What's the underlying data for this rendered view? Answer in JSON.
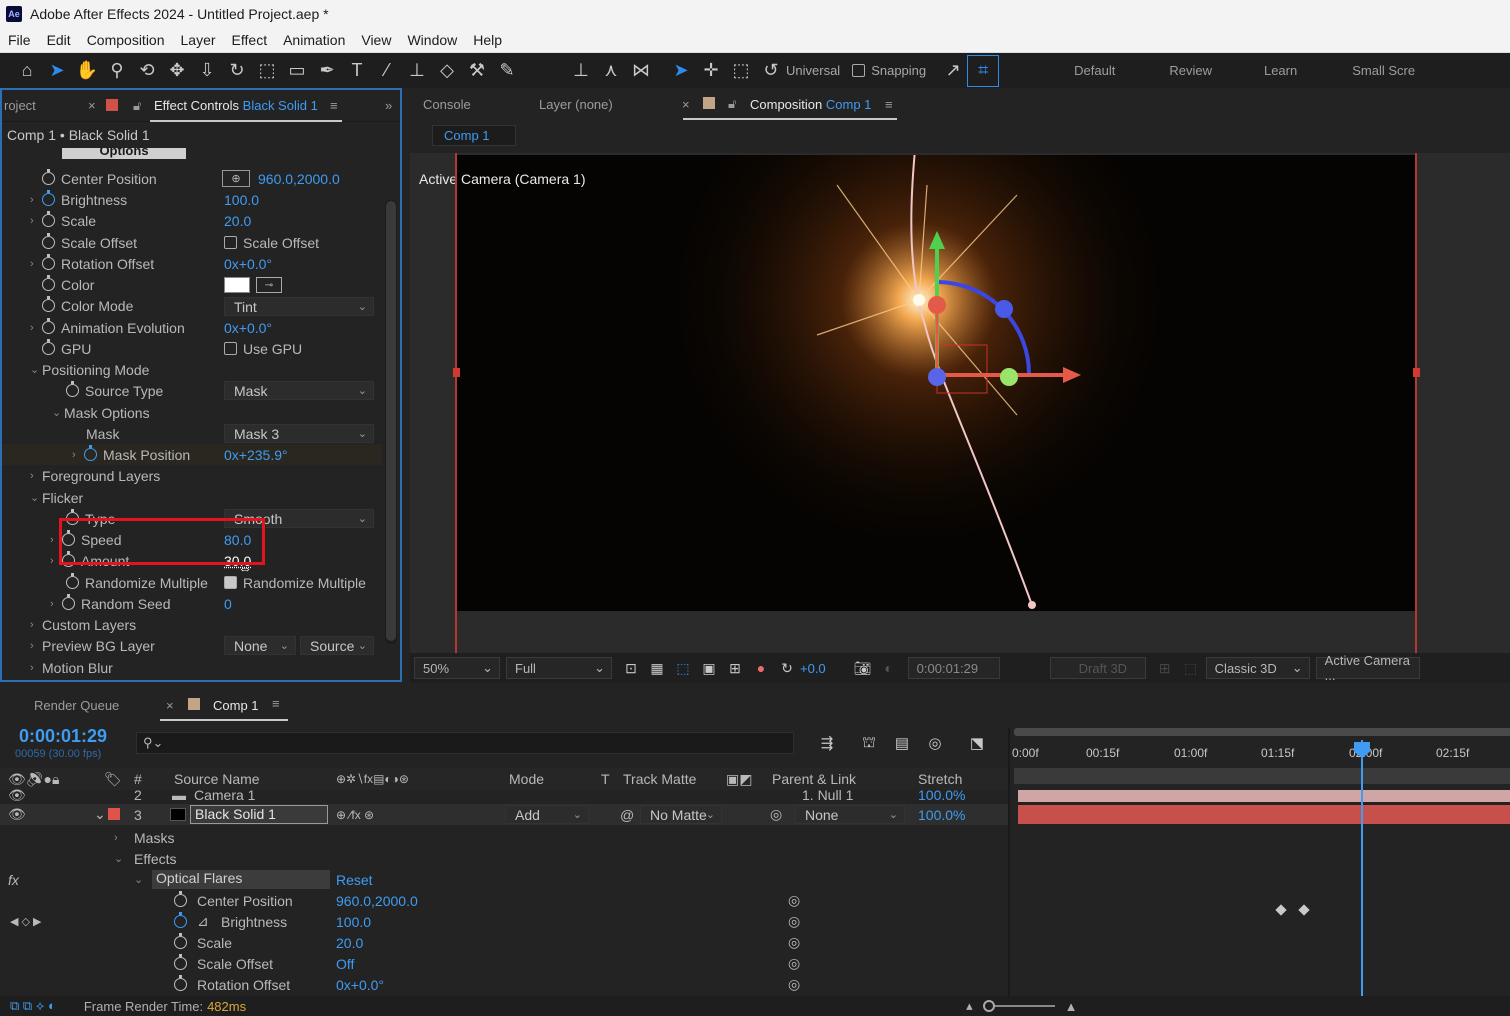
{
  "window": {
    "app_icon": "Ae",
    "title": "Adobe After Effects 2024 - Untitled Project.aep *"
  },
  "menu": [
    "File",
    "Edit",
    "Composition",
    "Layer",
    "Effect",
    "Animation",
    "View",
    "Window",
    "Help"
  ],
  "toolbar": {
    "universal_label": "Universal",
    "snapping_label": "Snapping",
    "workspaces": [
      "Default",
      "Review",
      "Learn",
      "Small Scre"
    ]
  },
  "effect_panel": {
    "project_tab": "roject",
    "tab_label": "Effect Controls",
    "tab_layer": "Black Solid 1",
    "breadcrumb": "Comp 1 • Black Solid 1",
    "options_button": "Options",
    "properties": {
      "center_position": {
        "label": "Center Position",
        "value": "960.0,2000.0"
      },
      "brightness": {
        "label": "Brightness",
        "value": "100.0"
      },
      "scale": {
        "label": "Scale",
        "value": "20.0"
      },
      "scale_offset": {
        "label": "Scale Offset",
        "checkbox_label": "Scale Offset"
      },
      "rotation_offset": {
        "label": "Rotation Offset",
        "value": "0x+0.0°"
      },
      "color": {
        "label": "Color"
      },
      "color_mode": {
        "label": "Color Mode",
        "value": "Tint"
      },
      "animation_evolution": {
        "label": "Animation Evolution",
        "value": "0x+0.0°"
      },
      "gpu": {
        "label": "GPU",
        "checkbox_label": "Use GPU"
      },
      "positioning_mode": {
        "label": "Positioning Mode"
      },
      "source_type": {
        "label": "Source Type",
        "value": "Mask"
      },
      "mask_options": {
        "label": "Mask Options"
      },
      "mask": {
        "label": "Mask",
        "value": "Mask 3"
      },
      "mask_position": {
        "label": "Mask Position",
        "value": "0x+235.9°"
      },
      "foreground_layers": {
        "label": "Foreground Layers"
      },
      "flicker": {
        "label": "Flicker"
      },
      "type": {
        "label": "Type",
        "value": "Smooth"
      },
      "speed": {
        "label": "Speed",
        "value": "80.0"
      },
      "amount": {
        "label": "Amount",
        "value": "30.0"
      },
      "randomize_multiple": {
        "label": "Randomize Multiple",
        "checkbox_label": "Randomize Multiple"
      },
      "random_seed": {
        "label": "Random Seed",
        "value": "0"
      },
      "custom_layers": {
        "label": "Custom Layers"
      },
      "preview_bg_layer": {
        "label": "Preview BG Layer",
        "value": "None",
        "value2": "Source"
      },
      "motion_blur": {
        "label": "Motion Blur"
      }
    }
  },
  "comp_panel": {
    "console_tab": "Console",
    "layer_tab": "Layer (none)",
    "comp_tab_label": "Composition",
    "comp_tab_name": "Comp 1",
    "subtab": "Comp 1",
    "camera_label": "Active Camera (Camera 1)",
    "zoom": "50%",
    "resolution": "Full",
    "exposure": "+0.0",
    "timecode": "0:00:01:29",
    "draft3d": "Draft 3D",
    "renderer": "Classic 3D",
    "view": "Active Camera ..."
  },
  "timeline": {
    "render_queue_tab": "Render Queue",
    "comp_tab": "Comp 1",
    "timecode": "0:00:01:29",
    "frame_info": "00059 (30.00 fps)",
    "search_placeholder": "",
    "columns": {
      "num": "#",
      "source_name": "Source Name",
      "mode": "Mode",
      "t": "T",
      "track_matte": "Track Matte",
      "parent": "Parent & Link",
      "stretch": "Stretch"
    },
    "ruler": [
      "0:00f",
      "00:15f",
      "01:00f",
      "01:15f",
      "02:00f",
      "02:15f"
    ],
    "layers": [
      {
        "num": "2",
        "name": "Camera 1",
        "parent": "1. Null 1",
        "stretch": "100.0%",
        "color": "#e8a8a8"
      },
      {
        "num": "3",
        "name": "Black Solid 1",
        "mode": "Add",
        "matte": "No Matte",
        "parent": "None",
        "stretch": "100.0%",
        "color": "#e0534a"
      }
    ],
    "groups": {
      "masks": "Masks",
      "effects": "Effects",
      "optical_flares": "Optical Flares",
      "reset": "Reset",
      "fx": "fx"
    },
    "props": [
      {
        "label": "Center Position",
        "value": "960.0,2000.0"
      },
      {
        "label": "Brightness",
        "value": "100.0"
      },
      {
        "label": "Scale",
        "value": "20.0"
      },
      {
        "label": "Scale Offset",
        "value": "Off"
      },
      {
        "label": "Rotation Offset",
        "value": "0x+0.0°"
      }
    ]
  },
  "status": {
    "frame_render_label": "Frame Render Time:",
    "frame_render_value": "482ms"
  },
  "colors": {
    "accent_blue": "#3f9cf2",
    "highlight_red": "#e3141b",
    "layer_bar_red": "#c8504a"
  }
}
